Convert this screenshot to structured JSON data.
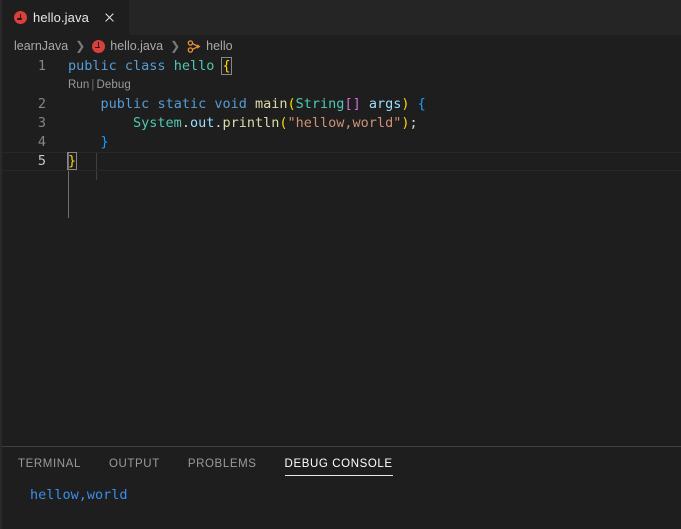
{
  "window": {
    "background": "#1e1e1e",
    "tabbar_background": "#252526"
  },
  "tabbar": {
    "tabs": [
      {
        "label": "hello.java",
        "icon": "java-file-icon",
        "active": true,
        "close_icon": "close-icon"
      }
    ]
  },
  "breadcrumb": {
    "separator": "❯",
    "items": [
      {
        "label": "learnJava",
        "icon": null
      },
      {
        "label": "hello.java",
        "icon": "java-file-icon"
      },
      {
        "label": "hello",
        "icon": "java-class-icon"
      }
    ]
  },
  "editor": {
    "language": "java",
    "codelens": {
      "run_label": "Run",
      "separator": "|",
      "debug_label": "Debug"
    },
    "active_line": 5,
    "lines": [
      {
        "number": "1",
        "indent": 0
      },
      {
        "number": "2",
        "indent": 1
      },
      {
        "number": "3",
        "indent": 2
      },
      {
        "number": "4",
        "indent": 1
      },
      {
        "number": "5",
        "indent": 0
      }
    ],
    "code": {
      "line1": {
        "kw_public": "public",
        "kw_class": "class",
        "name": "hello",
        "brace": "{"
      },
      "line2": {
        "kw_public": "public",
        "kw_static": "static",
        "kw_void": "void",
        "fn_main": "main",
        "paren_open": "(",
        "type_string": "String",
        "brackets": "[]",
        "arg_name": "args",
        "paren_close": ")",
        "brace": "{"
      },
      "line3": {
        "type_system": "System",
        "dot1": ".",
        "field_out": "out",
        "dot2": ".",
        "fn_println": "println",
        "paren_open": "(",
        "string_literal": "\"hellow,world\"",
        "paren_close": ")",
        "semicolon": ";"
      },
      "line4": {
        "brace": "}"
      },
      "line5": {
        "brace": "}"
      }
    },
    "colors": {
      "keyword": "#569cd6",
      "type": "#4ec9b0",
      "function": "#dcdcaa",
      "variable": "#9cdcfe",
      "string": "#ce9178",
      "punctuation": "#d4d4d4",
      "bracket_yellow": "#ffd700",
      "linenumber": "#858585",
      "linenumber_active": "#c6c6c6",
      "codelens": "#999999"
    }
  },
  "panel": {
    "tabs": [
      {
        "label": "TERMINAL",
        "active": false
      },
      {
        "label": "OUTPUT",
        "active": false
      },
      {
        "label": "PROBLEMS",
        "active": false
      },
      {
        "label": "DEBUG CONSOLE",
        "active": true
      }
    ],
    "debug_console": {
      "output_lines": [
        "hellow,world"
      ],
      "output_color": "#3b8eea"
    }
  }
}
